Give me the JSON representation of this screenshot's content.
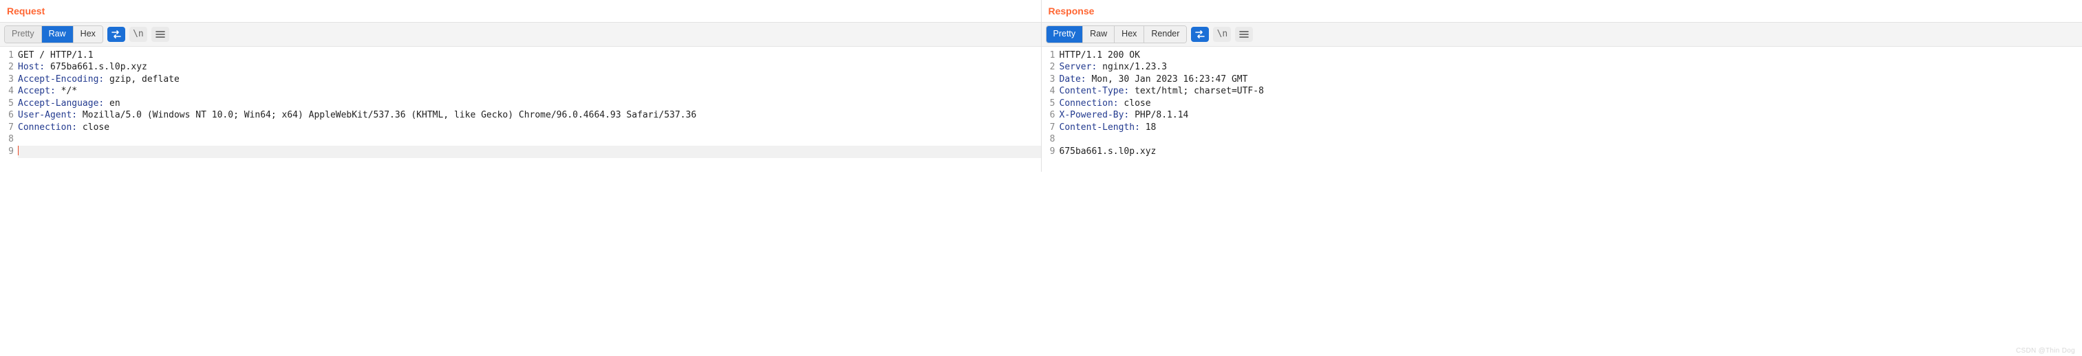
{
  "request": {
    "title": "Request",
    "tabs": {
      "pretty": "Pretty",
      "raw": "Raw",
      "hex": "Hex"
    },
    "active_tab": "raw",
    "lines": [
      {
        "n": 1,
        "text": "GET / HTTP/1.1"
      },
      {
        "n": 2,
        "header": "Host",
        "value": "675ba661.s.l0p.xyz"
      },
      {
        "n": 3,
        "header": "Accept-Encoding",
        "value": "gzip, deflate"
      },
      {
        "n": 4,
        "header": "Accept",
        "value": "*/*"
      },
      {
        "n": 5,
        "header": "Accept-Language",
        "value": "en"
      },
      {
        "n": 6,
        "header": "User-Agent",
        "value": "Mozilla/5.0 (Windows NT 10.0; Win64; x64) AppleWebKit/537.36 (KHTML, like Gecko) Chrome/96.0.4664.93 Safari/537.36"
      },
      {
        "n": 7,
        "header": "Connection",
        "value": "close"
      },
      {
        "n": 8,
        "text": ""
      },
      {
        "n": 9,
        "text": "",
        "caret": true
      }
    ]
  },
  "response": {
    "title": "Response",
    "tabs": {
      "pretty": "Pretty",
      "raw": "Raw",
      "hex": "Hex",
      "render": "Render"
    },
    "active_tab": "pretty",
    "lines": [
      {
        "n": 1,
        "text": "HTTP/1.1 200 OK"
      },
      {
        "n": 2,
        "header": "Server",
        "value": "nginx/1.23.3"
      },
      {
        "n": 3,
        "header": "Date",
        "value": "Mon, 30 Jan 2023 16:23:47 GMT"
      },
      {
        "n": 4,
        "header": "Content-Type",
        "value": "text/html; charset=UTF-8"
      },
      {
        "n": 5,
        "header": "Connection",
        "value": "close"
      },
      {
        "n": 6,
        "header": "X-Powered-By",
        "value": "PHP/8.1.14"
      },
      {
        "n": 7,
        "header": "Content-Length",
        "value": "18"
      },
      {
        "n": 8,
        "text": ""
      },
      {
        "n": 9,
        "text": "675ba661.s.l0p.xyz"
      }
    ]
  },
  "tool_labels": {
    "action": "action-swap-icon",
    "newline": "newline-icon",
    "menu": "menu-icon"
  },
  "watermark": "CSDN @Thin Dog"
}
